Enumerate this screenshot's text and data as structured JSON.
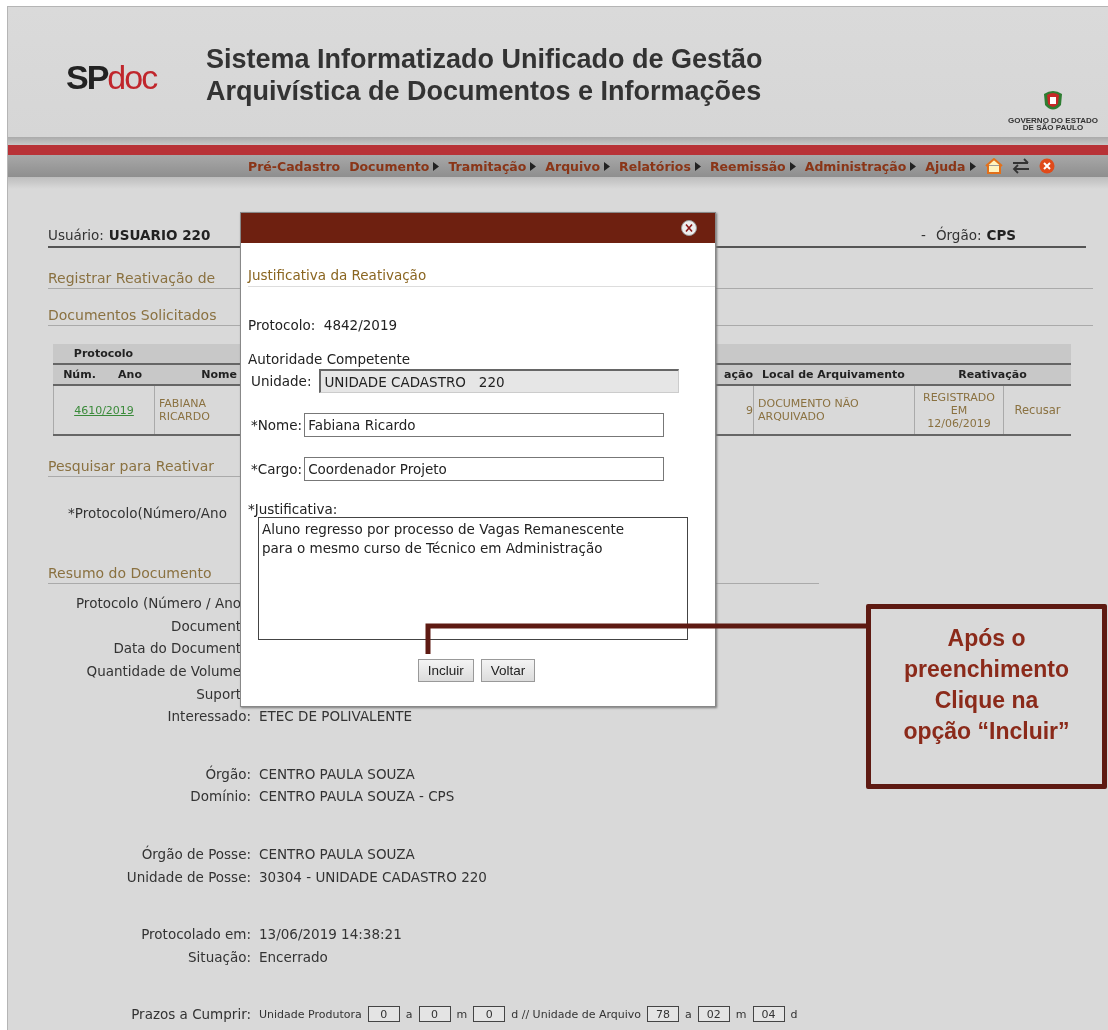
{
  "header": {
    "logo": {
      "sp": "SP",
      "doc": "doc"
    },
    "title_lines": [
      "Sistema Informatizado Unificado de Gestão",
      "Arquivística de Documentos e Informações"
    ],
    "government": [
      "GOVERNO DO ESTADO",
      "DE SÃO PAULO"
    ]
  },
  "nav": {
    "items": [
      {
        "label": "Pré-Cadastro",
        "submenu": false
      },
      {
        "label": "Documento",
        "submenu": true
      },
      {
        "label": "Tramitação",
        "submenu": true
      },
      {
        "label": "Arquivo",
        "submenu": true
      },
      {
        "label": "Relatórios",
        "submenu": true
      },
      {
        "label": "Reemissão",
        "submenu": true
      },
      {
        "label": "Administração",
        "submenu": true
      },
      {
        "label": "Ajuda",
        "submenu": true
      }
    ]
  },
  "user_bar": {
    "user_label": "Usuário:",
    "user": "USUARIO 220",
    "separator": "-",
    "org_label": "Órgão:",
    "org": "CPS"
  },
  "register_title": "Registrar Reativação de",
  "requested_title": "Documentos Solicitados",
  "table": {
    "protocol_group": "Protocolo",
    "columns": [
      "Núm.",
      "Ano",
      "Nome",
      "ação",
      "Local de Arquivamento",
      "Reativação"
    ],
    "rows": [
      {
        "protocol": "4610/2019",
        "name": "FABIANA RICARDO",
        "column_4": "9",
        "location": "DOCUMENTO NÃO ARQUIVADO",
        "status": "REGISTRADO EM 12/06/2019",
        "action": "Recusar"
      }
    ]
  },
  "search_title": "Pesquisar para Reativar",
  "search_label": "*Protocolo(Número/Ano",
  "summary_title": "Resumo do Documento",
  "summary_groups": [
    [
      {
        "kind": "clipped",
        "label": "Protocolo (Número / Ano"
      },
      {
        "kind": "clipped",
        "label": "Document"
      },
      {
        "kind": "clipped",
        "label": "Data do Document"
      },
      {
        "kind": "clipped",
        "label": "Quantidade de Volume"
      },
      {
        "kind": "clipped",
        "label": "Suport"
      },
      {
        "kind": "field",
        "label": "Interessado:",
        "value": "ETEC DE POLIVALENTE"
      }
    ],
    [
      {
        "kind": "field",
        "label": "Órgão:",
        "value": "CENTRO PAULA SOUZA"
      },
      {
        "kind": "field",
        "label": "Domínio:",
        "value": "CENTRO PAULA SOUZA - CPS"
      }
    ],
    [
      {
        "kind": "field",
        "label": "Órgão de Posse:",
        "value": "CENTRO PAULA SOUZA"
      },
      {
        "kind": "field",
        "label": "Unidade de Posse:",
        "value": "30304 - UNIDADE CADASTRO 220"
      }
    ],
    [
      {
        "kind": "field",
        "label": "Protocolado em:",
        "value": "13/06/2019 14:38:21"
      },
      {
        "kind": "field",
        "label": "Situação:",
        "value": "Encerrado"
      }
    ]
  ],
  "deadlines": {
    "label": "Prazos a Cumprir:",
    "parts": [
      {
        "kind": "text",
        "text": "Unidade Produtora"
      },
      {
        "kind": "box",
        "text": "0"
      },
      {
        "kind": "text",
        "text": "a"
      },
      {
        "kind": "box",
        "text": "0"
      },
      {
        "kind": "text",
        "text": "m"
      },
      {
        "kind": "box",
        "text": "0"
      },
      {
        "kind": "text",
        "text": "d // Unidade de Arquivo"
      },
      {
        "kind": "box",
        "text": "78"
      },
      {
        "kind": "text",
        "text": "a"
      },
      {
        "kind": "box",
        "text": "02"
      },
      {
        "kind": "text",
        "text": "m"
      },
      {
        "kind": "box",
        "text": "04"
      },
      {
        "kind": "text",
        "text": "d"
      }
    ]
  },
  "dialog": {
    "title": "Justificativa da Reativação",
    "protocol_label": "Protocolo:",
    "protocol": "4842/2019",
    "authority": "Autoridade Competente",
    "fields": [
      {
        "label": "Unidade:",
        "value": "UNIDADE CADASTRO   220",
        "disabled": true
      },
      {
        "label": "*Nome:",
        "value": "Fabiana Ricardo",
        "disabled": false
      },
      {
        "label": "*Cargo:",
        "value": "Coordenador Projeto",
        "disabled": false
      }
    ],
    "justification_label": "*Justificativa:",
    "justification": "Aluno regresso por processo de Vagas Remanescente\npara o mesmo curso de Técnico em Administração",
    "buttons": [
      "Incluir",
      "Voltar"
    ]
  },
  "callout": {
    "lines": [
      "Após o",
      "preenchimento",
      "Clique na",
      "opção “Incluir”"
    ]
  }
}
